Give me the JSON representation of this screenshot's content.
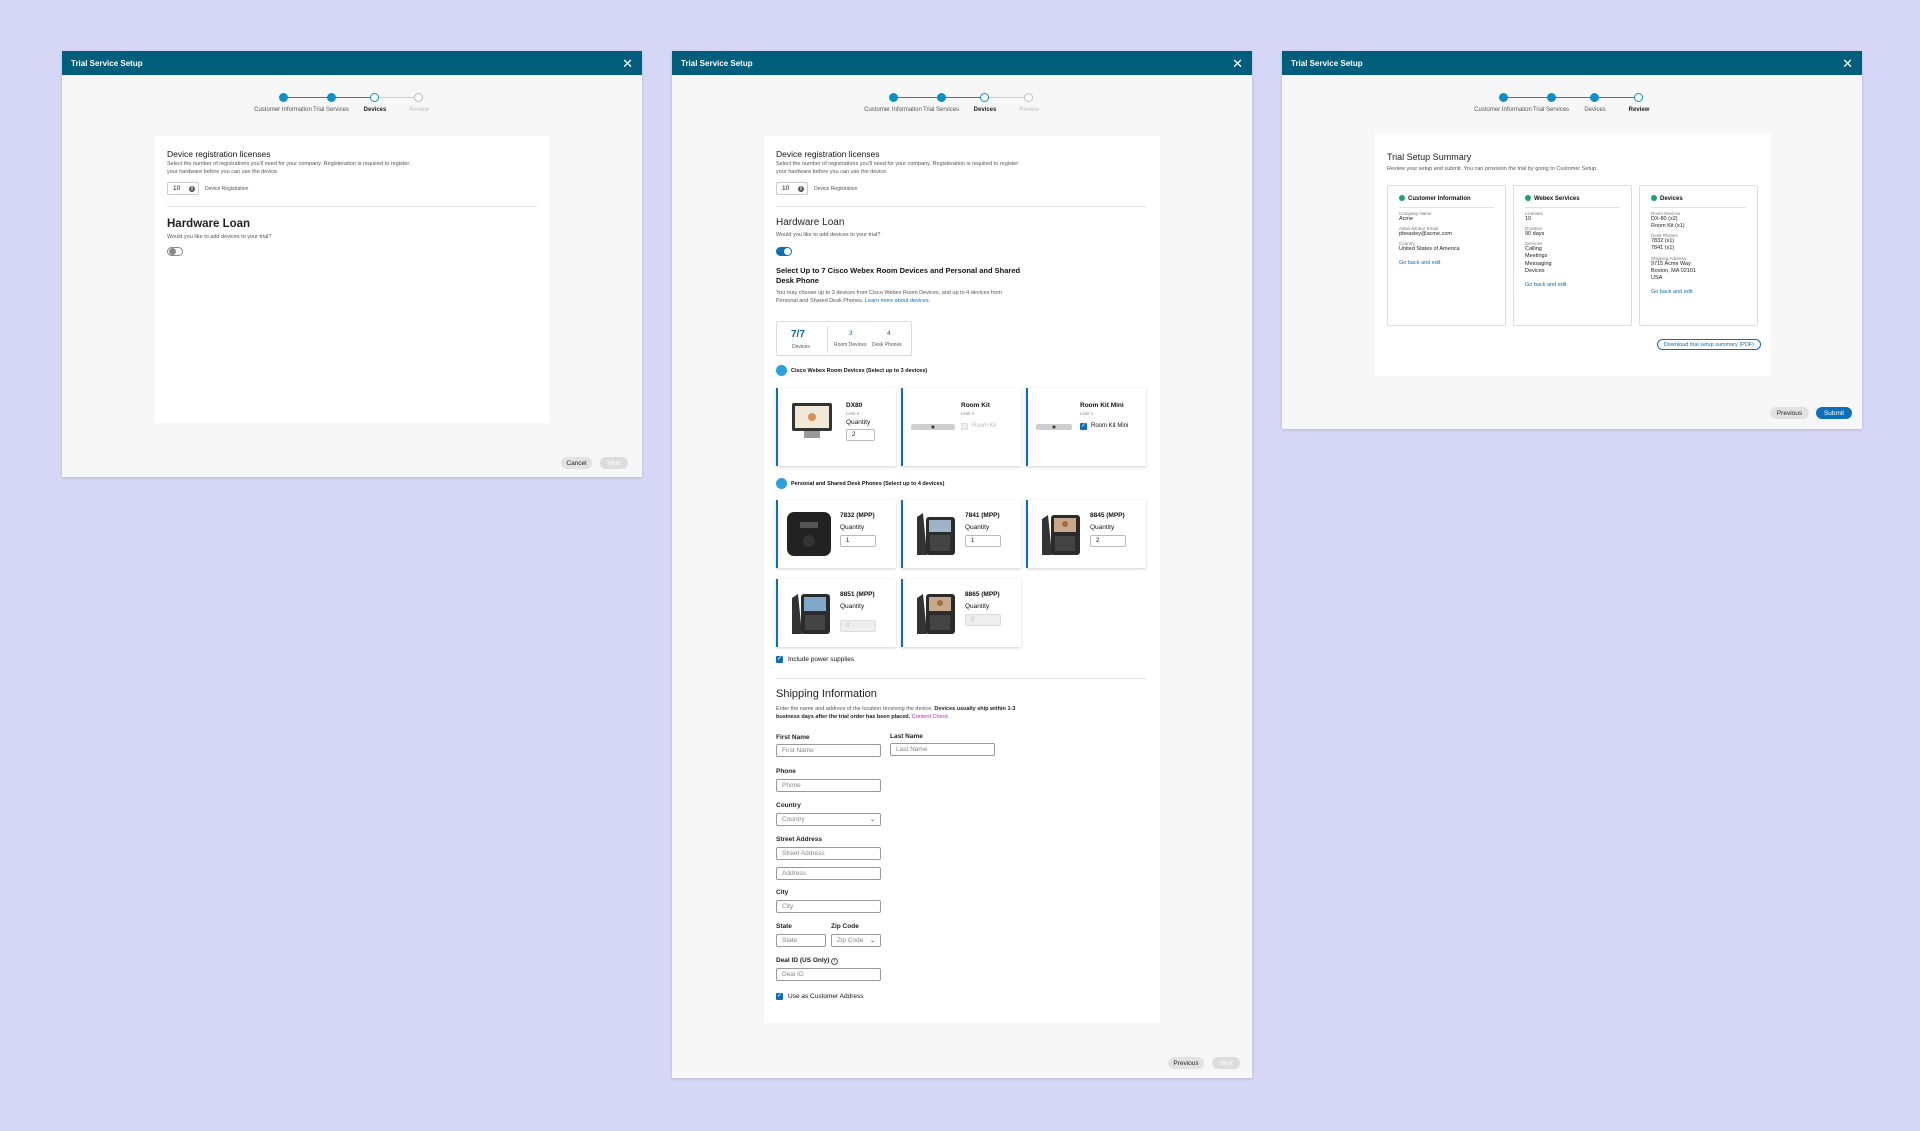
{
  "colors": {
    "header": "#005e7d",
    "accent": "#0d6fb8",
    "background": "#d6d7f7",
    "link_pink": "#d21ea8",
    "success": "#1fa36a"
  },
  "header_title": "Trial Service Setup",
  "steps": [
    "Customer Information",
    "Trial Services",
    "Devices",
    "Review"
  ],
  "device_licenses": {
    "title": "Device registration licenses",
    "desc": "Select the number of registrations you'll need for your company. Registeration is required to register your hardware before you can use the device.",
    "value": "10",
    "unit": "Device Registration"
  },
  "hardware_loan": {
    "title": "Hardware Loan",
    "question": "Would you like to add devices to your trial?"
  },
  "modal1": {
    "enabled": false,
    "cancel": "Cancel",
    "next": "Next"
  },
  "modal2": {
    "enabled": true,
    "select_title": "Select Up to 7 Cisco Webex Room Devices and Personal and Shared Desk Phone",
    "select_desc": "You may choose up to 3 devices from Cisco Webex Room Devices, and up to 4 devices from Personal and Shared Desk Phones.",
    "learn_more": "Learn more about devices.",
    "summary": {
      "total": "7/7",
      "total_label": "Devices",
      "room": "3",
      "room_label": "Room Devices",
      "desk": "4",
      "desk_label": "Desk Phones"
    },
    "room_section": "Cisco Webex Room Devices (Select up to 3 devices)",
    "room_devices": [
      {
        "name": "DX80",
        "limit": "Limit 3",
        "qty_label": "Quantity",
        "qty": "2"
      },
      {
        "name": "Room Kit",
        "limit": "Limit 1",
        "check_label": "Room Kit",
        "checked": false
      },
      {
        "name": "Room Kit Mini",
        "limit": "Limit 1",
        "check_label": "Room Kit Mini",
        "checked": true
      }
    ],
    "phone_section": "Personal and Shared Desk Phones (Select up to 4 devices)",
    "phones": [
      {
        "name": "7832 (MPP)",
        "qty_label": "Quantity",
        "qty": "1"
      },
      {
        "name": "7841 (MPP)",
        "qty_label": "Quantity",
        "qty": "1"
      },
      {
        "name": "8845 (MPP)",
        "qty_label": "Quantity",
        "qty": "2"
      },
      {
        "name": "8851 (MPP)",
        "qty_label": "Quantity",
        "qty": "0"
      },
      {
        "name": "8865 (MPP)",
        "qty_label": "Quantity",
        "qty": "0"
      }
    ],
    "power_supplies": "Include power supplies",
    "shipping": {
      "title": "Shipping Information",
      "desc": "Enter the name and address of the location receiving the device.",
      "desc_bold": "Devices usually ship within 1-3 business days after the trial order has been placed.",
      "content_check": "Content Check",
      "first_name_label": "First Name",
      "first_name_ph": "First Name",
      "last_name_label": "Last Name",
      "last_name_ph": "Last Name",
      "phone_label": "Phone",
      "phone_ph": "Phone",
      "country_label": "Country",
      "country_ph": "Country",
      "street_label": "Street Address",
      "street_ph": "Street Address",
      "address_ph": "Address",
      "city_label": "City",
      "city_ph": "City",
      "state_label": "State",
      "state_ph": "State",
      "zip_label": "Zip Code",
      "zip_ph": "Zip Code",
      "deal_label": "Deal ID (US Only)",
      "deal_ph": "Deal ID",
      "use_customer": "Use as Customer Address"
    },
    "previous": "Previous",
    "next": "Next"
  },
  "modal3": {
    "title": "Trial Setup Summary",
    "desc": "Review your setup and submit. You can provision the  trial by going to Customer Setup.",
    "customer": {
      "title": "Customer Information",
      "k1": "Company Name",
      "v1": "Acme",
      "k2": "Administrator Email",
      "v2": "pbeasley@acme.com",
      "k3": "Country",
      "v3": "United States of America",
      "link": "Go back and edit"
    },
    "webex": {
      "title": "Webex Services",
      "k1": "Licenses",
      "v1": "10",
      "k2": "Duration",
      "v2": "90 days",
      "k3": "Services",
      "v3a": "Calling",
      "v3b": "Meetings",
      "v3c": "Messaging",
      "v3d": "Devices",
      "link": "Go back and edit"
    },
    "devices": {
      "title": "Devices",
      "k1": "Room Devices",
      "v1a": "DX-80 (x2)",
      "v1b": "Room Kit (x1)",
      "k2": "Desk Phones",
      "v2a": "7832 (x1)",
      "v2b": "7841 (x1)",
      "k3": "Shipping Address",
      "v3a": "9715 Acme Way",
      "v3b": "Boston, MA 02101",
      "v3c": "USA",
      "link": "Go back and edit"
    },
    "download": "Download trial setup summary (PDF)",
    "previous": "Previous",
    "submit": "Submit"
  }
}
